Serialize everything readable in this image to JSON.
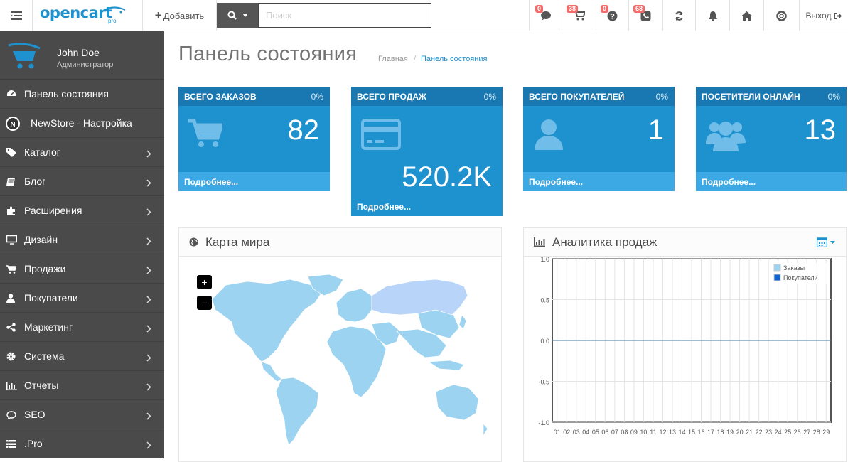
{
  "header": {
    "logo": "opencart",
    "logo_sub": "pro",
    "add_label": "Добавить",
    "search_placeholder": "Поиск",
    "badges": {
      "messages": "0",
      "orders": "38",
      "questions": "0",
      "reviews": "68"
    },
    "logout_label": "Выход"
  },
  "profile": {
    "name": "John Doe",
    "role": "Администратор"
  },
  "menu": [
    {
      "label": "Панель состояния",
      "icon": "dashboard-icon",
      "arrow": false
    },
    {
      "label": "NewStore - Настройка",
      "icon": "newstore-icon",
      "arrow": false
    },
    {
      "label": "Каталог",
      "icon": "tag-icon",
      "arrow": true
    },
    {
      "label": "Блог",
      "icon": "book-icon",
      "arrow": true
    },
    {
      "label": "Расширения",
      "icon": "puzzle-icon",
      "arrow": true
    },
    {
      "label": "Дизайн",
      "icon": "monitor-icon",
      "arrow": true
    },
    {
      "label": "Продажи",
      "icon": "cart-icon",
      "arrow": true
    },
    {
      "label": "Покупатели",
      "icon": "user-icon",
      "arrow": true
    },
    {
      "label": "Маркетинг",
      "icon": "share-icon",
      "arrow": true
    },
    {
      "label": "Система",
      "icon": "cog-icon",
      "arrow": true
    },
    {
      "label": "Отчеты",
      "icon": "bar-chart-icon",
      "arrow": true
    },
    {
      "label": "SEO",
      "icon": "comment-icon",
      "arrow": true
    },
    {
      "label": ".Pro",
      "icon": "list-icon",
      "arrow": true
    }
  ],
  "page": {
    "title": "Панель состояния",
    "breadcrumb": [
      "Главная",
      "Панель состояния"
    ]
  },
  "tiles": [
    {
      "title": "ВСЕГО ЗАКАЗОВ",
      "percent": "0%",
      "value": "82",
      "more": "Подробнее...",
      "icon": "cart-icon"
    },
    {
      "title": "ВСЕГО ПРОДАЖ",
      "percent": "0%",
      "value": "520.2K",
      "more": "Подробнее...",
      "icon": "credit-card-icon"
    },
    {
      "title": "ВСЕГО ПОКУПАТЕЛЕЙ",
      "percent": "0%",
      "value": "1",
      "more": "Подробнее...",
      "icon": "user-icon"
    },
    {
      "title": "ПОСЕТИТЕЛИ ОНЛАЙН",
      "percent": "0%",
      "value": "13",
      "more": "Подробнее...",
      "icon": "users-icon"
    }
  ],
  "map_panel": {
    "title": "Карта мира",
    "zoom_in": "+",
    "zoom_out": "−"
  },
  "sales_panel": {
    "title": "Аналитика продаж"
  },
  "colors": {
    "sidebar": "#4a4a4a",
    "tile": "#1e91cf",
    "tile_head": "#1978b1",
    "tile_foot": "#3da9e4",
    "map_land": "#9cd3f0",
    "map_highlight": "#b8d4f8",
    "badge": "#f56b6b"
  },
  "chart_data": {
    "type": "line",
    "x": [
      "01",
      "02",
      "03",
      "04",
      "05",
      "06",
      "07",
      "08",
      "09",
      "10",
      "11",
      "12",
      "13",
      "14",
      "15",
      "16",
      "17",
      "18",
      "19",
      "20",
      "21",
      "22",
      "23",
      "24",
      "25",
      "26",
      "27",
      "28",
      "29"
    ],
    "series": [
      {
        "name": "Заказы",
        "color": "#9cd3f0",
        "values": [
          0,
          0,
          0,
          0,
          0,
          0,
          0,
          0,
          0,
          0,
          0,
          0,
          0,
          0,
          0,
          0,
          0,
          0,
          0,
          0,
          0,
          0,
          0,
          0,
          0,
          0,
          0,
          0,
          0
        ]
      },
      {
        "name": "Покупатели",
        "color": "#1065d4",
        "values": [
          0,
          0,
          0,
          0,
          0,
          0,
          0,
          0,
          0,
          0,
          0,
          0,
          0,
          0,
          0,
          0,
          0,
          0,
          0,
          0,
          0,
          0,
          0,
          0,
          0,
          0,
          0,
          0,
          0
        ]
      }
    ],
    "ylim": [
      -1.0,
      1.0
    ],
    "yticks": [
      "1.0",
      "0.5",
      "0.0",
      "-0.5",
      "-1.0"
    ],
    "grid": true,
    "legend": "top-right"
  }
}
